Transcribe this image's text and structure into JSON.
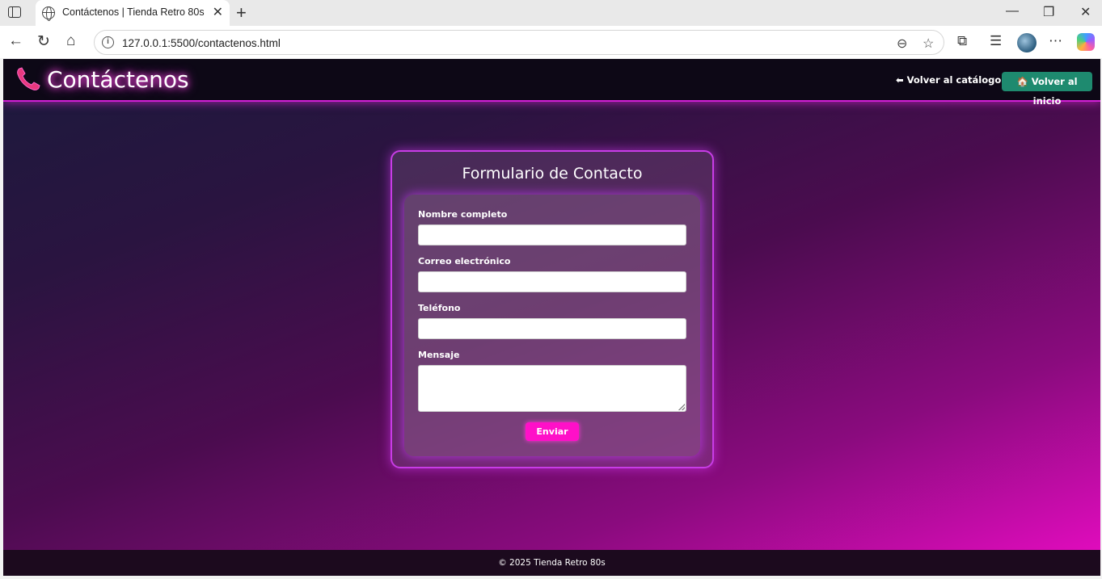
{
  "browser": {
    "tab_title": "Contáctenos | Tienda Retro 80s",
    "url": "127.0.0.1:5500/contactenos.html"
  },
  "header": {
    "title": "Contáctenos",
    "back_catalog_label": "⬅ Volver al catálogo",
    "home_label": "🏠 Volver al inicio"
  },
  "form": {
    "title": "Formulario de Contacto",
    "fields": [
      {
        "label": "Nombre completo",
        "value": ""
      },
      {
        "label": "Correo electrónico",
        "value": ""
      },
      {
        "label": "Teléfono",
        "value": ""
      },
      {
        "label": "Mensaje",
        "value": ""
      }
    ],
    "submit_label": "Enviar"
  },
  "footer": {
    "text": "© 2025 Tienda Retro 80s"
  },
  "colors": {
    "neon_pink": "#ff10c8",
    "header_bg": "#0d0816",
    "home_button": "#1e8a6f"
  }
}
